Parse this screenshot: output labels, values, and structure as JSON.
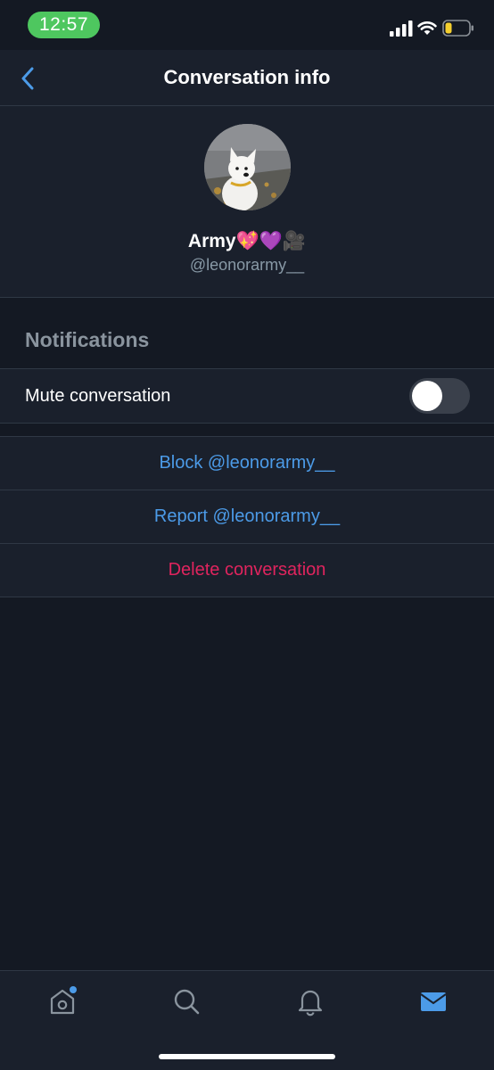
{
  "status_bar": {
    "time": "12:57",
    "signal_icon": "cellular-signal-icon",
    "wifi_icon": "wifi-icon",
    "battery_icon": "battery-low-icon"
  },
  "header": {
    "title": "Conversation info",
    "back_icon": "chevron-left-icon"
  },
  "profile": {
    "display_name": "Army💖💜🎥",
    "handle": "@leonorarmy__",
    "avatar_description": "avatar"
  },
  "notifications": {
    "section_title": "Notifications",
    "mute_label": "Mute conversation",
    "mute_enabled": false
  },
  "actions": {
    "block_label": "Block @leonorarmy__",
    "report_label": "Report @leonorarmy__",
    "delete_label": "Delete conversation"
  },
  "tab_bar": {
    "tabs": [
      {
        "icon": "home-icon",
        "active": false,
        "has_dot": true
      },
      {
        "icon": "search-icon",
        "active": false
      },
      {
        "icon": "bell-icon",
        "active": false
      },
      {
        "icon": "mail-icon",
        "active": true
      }
    ]
  },
  "colors": {
    "background": "#141923",
    "surface": "#1a202c",
    "accent_blue": "#4c9be8",
    "destructive_red": "#e0245e",
    "secondary_text": "#8899a6",
    "status_pill_green": "#4ec75f"
  }
}
